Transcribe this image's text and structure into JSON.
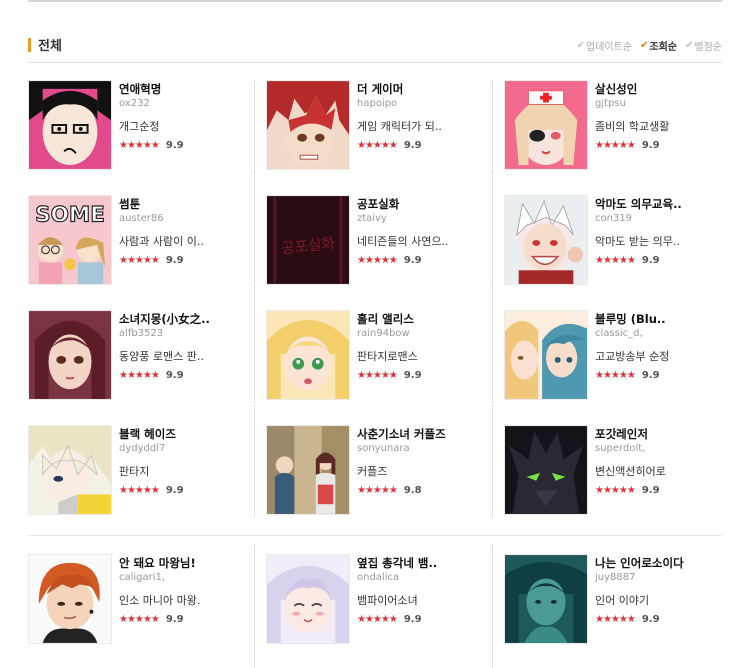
{
  "header": {
    "title": "전체",
    "sort": [
      {
        "label": "업데이트순",
        "active": false
      },
      {
        "label": "조회순",
        "active": true
      },
      {
        "label": "별점순",
        "active": false
      }
    ]
  },
  "stars": "★★★★★",
  "comics": [
    {
      "title": "연애혁명",
      "author": "ox232",
      "desc": "개그순정",
      "score": "9.9"
    },
    {
      "title": "더 게이머",
      "author": "hapoipo",
      "desc": "게임 캐릭터가 되..",
      "score": "9.9"
    },
    {
      "title": "살신성인",
      "author": "gjtpsu",
      "desc": "좀비의 학교생활",
      "score": "9.9"
    },
    {
      "title": "썸툰",
      "author": "auster86",
      "desc": "사람과 사람이 이..",
      "score": "9.9"
    },
    {
      "title": "공포실화",
      "author": "ztaivy",
      "desc": "네티즌들의 사연으..",
      "score": "9.9"
    },
    {
      "title": "악마도 의무교육..",
      "author": "con319",
      "desc": "악마도 받는 의무..",
      "score": "9.9"
    },
    {
      "title": "소녀지몽(小女之..",
      "author": "alfb3523",
      "desc": "동양풍 로맨스 판..",
      "score": "9.9"
    },
    {
      "title": "홀리 앨리스",
      "author": "rain94bow",
      "desc": "판타지로맨스",
      "score": "9.9"
    },
    {
      "title": "블루밍 (Blu..",
      "author": "classic_d,",
      "desc": "고교방송부 순정",
      "score": "9.9"
    },
    {
      "title": "블랙 헤이즈",
      "author": "dydyddl7",
      "desc": "판타지",
      "score": "9.9"
    },
    {
      "title": "사춘기소녀 커플즈",
      "author": "sonyunara",
      "desc": "커플즈",
      "score": "9.8"
    },
    {
      "title": "포갓레인저",
      "author": "superdolt,",
      "desc": "변신액션히어로",
      "score": "9.9"
    },
    {
      "title": "안 돼요 마왕님!",
      "author": "caligari1,",
      "desc": "인소 마니아 마왕.",
      "score": "9.9"
    },
    {
      "title": "옆집 총각네 뱀..",
      "author": "ondalica",
      "desc": "뱀파이어소녀",
      "score": "9.9"
    },
    {
      "title": "나는 인어로소이다",
      "author": "juy8887",
      "desc": "인어 이야기",
      "score": "9.9"
    }
  ],
  "thumbnail_texts": {
    "some": "SOME",
    "horror": "공포실화"
  }
}
